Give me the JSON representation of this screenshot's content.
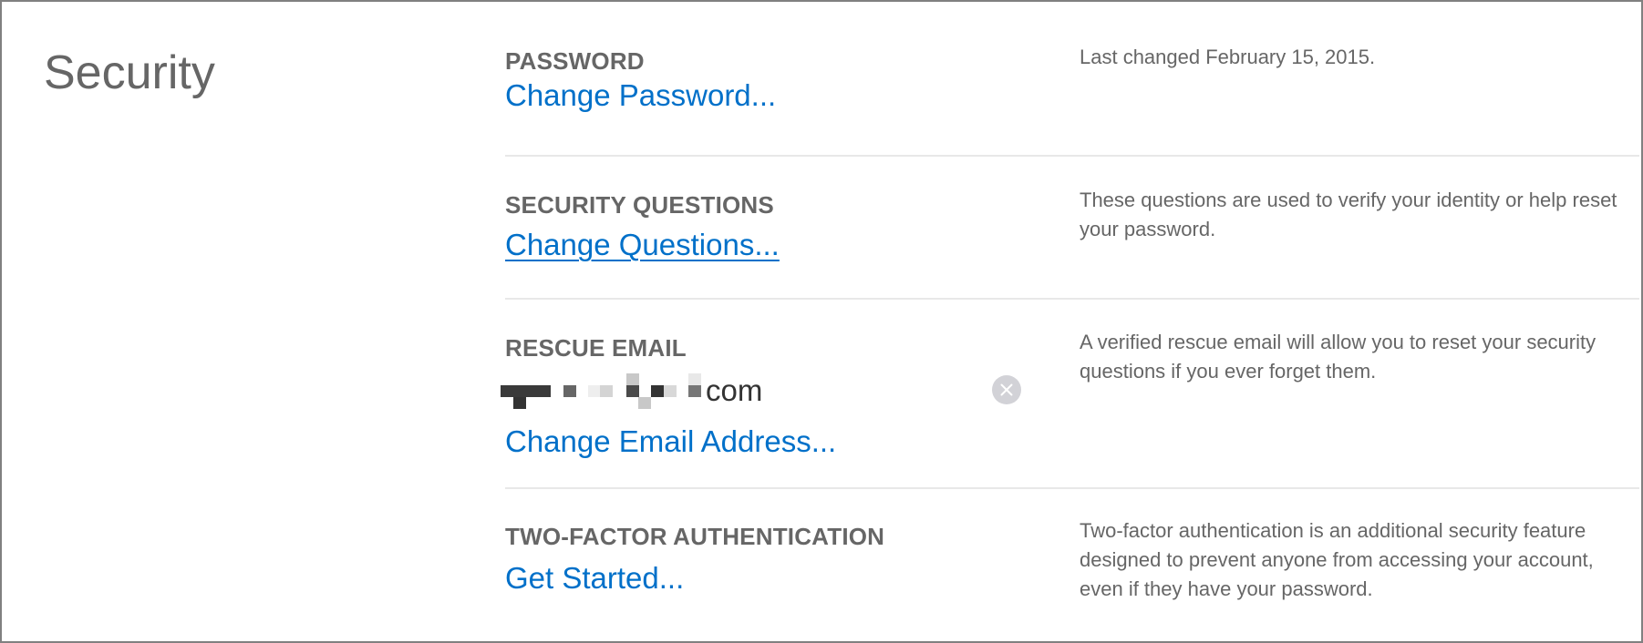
{
  "page": {
    "title": "Security"
  },
  "sections": [
    {
      "header": "PASSWORD",
      "link": "Change Password...",
      "description": "Last changed February 15, 2015."
    },
    {
      "header": "SECURITY QUESTIONS",
      "link": "Change Questions...",
      "description": "These questions are used to verify your identity or help reset your password."
    },
    {
      "header": "RESCUE EMAIL",
      "email_value": {
        "visible_suffix": "com",
        "redacted": true
      },
      "clear_icon": "clear-circle-x-icon",
      "link": "Change Email Address...",
      "description": "A verified rescue email will allow you to reset your security questions if you ever forget them."
    },
    {
      "header": "TWO-FACTOR AUTHENTICATION",
      "link": "Get Started...",
      "description": "Two-factor authentication is an additional security feature designed to prevent anyone from accessing your account, even if they have your password."
    }
  ],
  "colors": {
    "link": "#0070c9",
    "text_secondary": "#666666",
    "divider": "#e8e8e8",
    "clear_button": "#d2d2d7"
  }
}
